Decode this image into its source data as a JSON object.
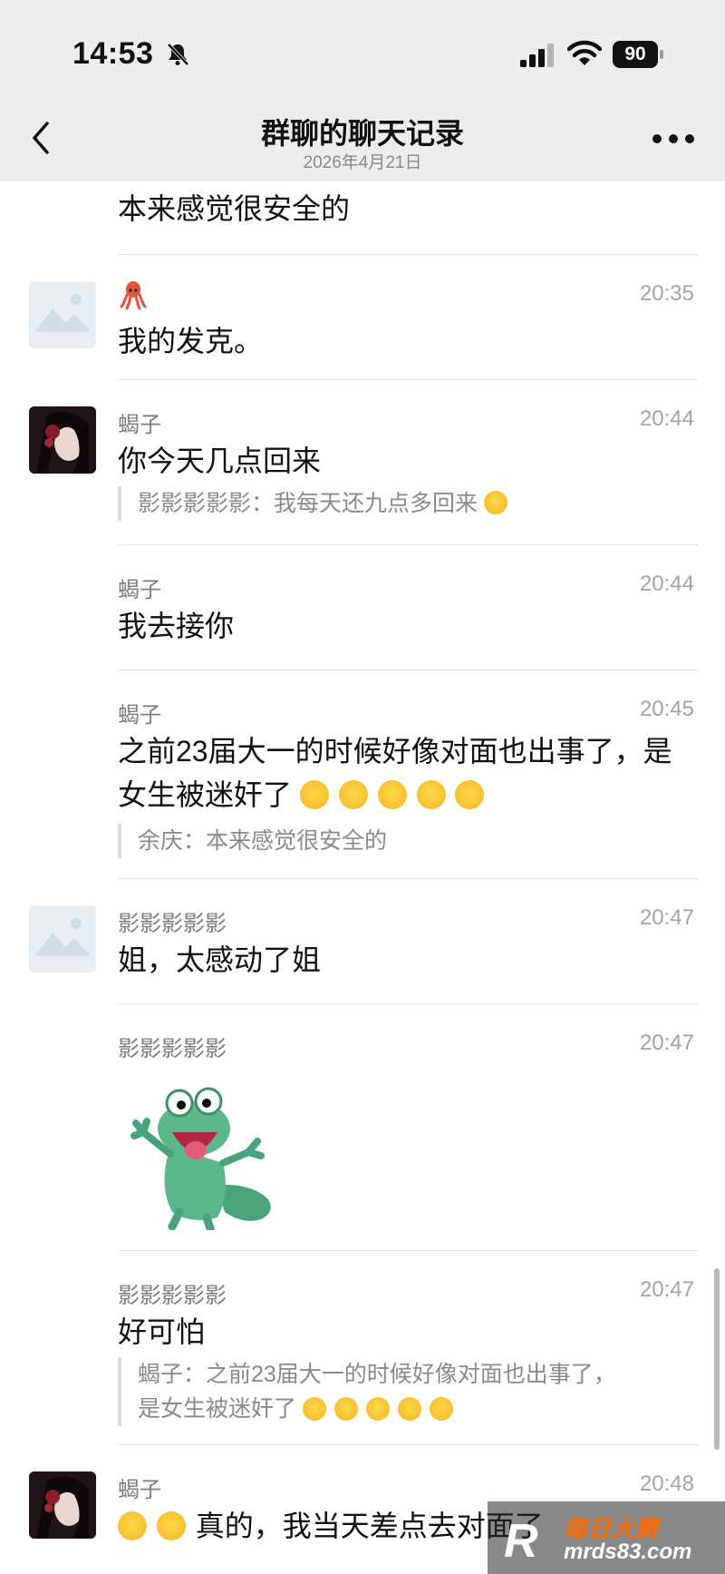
{
  "status_bar": {
    "time": "14:53",
    "battery": "90"
  },
  "header": {
    "title": "群聊的聊天记录",
    "date": "2026年4月21日"
  },
  "messages": [
    {
      "text": "本来感觉很安全的"
    },
    {
      "name": "",
      "time": "20:35",
      "text": "我的发克。",
      "avatar": "placeholder"
    },
    {
      "name": "蝎子",
      "time": "20:44",
      "text": "你今天几点回来",
      "quote": "影影影影影：我每天还九点多回来",
      "avatar": "dark"
    },
    {
      "name": "蝎子",
      "time": "20:44",
      "text": "我去接你"
    },
    {
      "name": "蝎子",
      "time": "20:45",
      "text_line1": "之前23届大一的时候好像对面也出事了，是",
      "text_line2": "女生被迷奸了",
      "quote": "余庆：本来感觉很安全的"
    },
    {
      "name": "影影影影影",
      "time": "20:47",
      "text": "姐，太感动了姐",
      "avatar": "placeholder"
    },
    {
      "name": "影影影影影",
      "time": "20:47",
      "sticker": "frog-sticker"
    },
    {
      "name": "影影影影影",
      "time": "20:47",
      "text": "好可怕",
      "quote_line1": "蝎子：之前23届大一的时候好像对面也出事了，",
      "quote_line2": "是女生被迷奸了"
    },
    {
      "name": "蝎子",
      "time": "20:48",
      "text": "真的，我当天差点去对面了",
      "avatar": "dark"
    }
  ],
  "watermark": {
    "mark": "R",
    "line1": "每日大赛",
    "line2": "mrds83.com"
  },
  "icons": {
    "back": "chevron-left-icon",
    "more": "more-dots-icon",
    "bell": "bell-slash-icon",
    "signal": "cellular-signal-icon",
    "wifi": "wifi-icon",
    "battery": "battery-icon",
    "cry_emoji": "loudly-crying-face-icon",
    "scream_emoji": "screaming-face-icon",
    "laugh_emoji": "rolling-laughing-face-icon"
  },
  "colors": {
    "header_bg": "#ededed",
    "divider": "#e3e3e3",
    "meta_text": "#7d7d7d",
    "watermark_accent": "#ff6a00"
  }
}
